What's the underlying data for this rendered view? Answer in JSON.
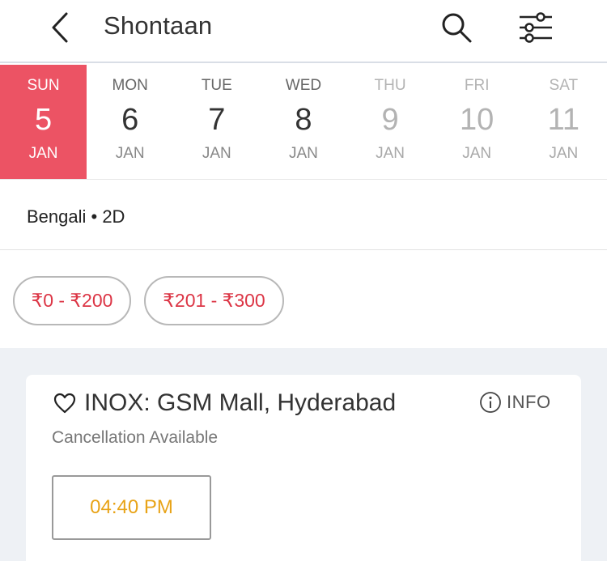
{
  "header": {
    "title": "Shontaan",
    "icons": {
      "back": "chevron-left-icon",
      "search": "search-icon",
      "filter": "sliders-icon"
    }
  },
  "dates": [
    {
      "dow": "SUN",
      "day": "5",
      "mon": "JAN",
      "state": "selected"
    },
    {
      "dow": "MON",
      "day": "6",
      "mon": "JAN",
      "state": "available"
    },
    {
      "dow": "TUE",
      "day": "7",
      "mon": "JAN",
      "state": "available"
    },
    {
      "dow": "WED",
      "day": "8",
      "mon": "JAN",
      "state": "available"
    },
    {
      "dow": "THU",
      "day": "9",
      "mon": "JAN",
      "state": "disabled"
    },
    {
      "dow": "FRI",
      "day": "10",
      "mon": "JAN",
      "state": "disabled"
    },
    {
      "dow": "SAT",
      "day": "11",
      "mon": "JAN",
      "state": "disabled"
    }
  ],
  "format": {
    "text": "Bengali • 2D"
  },
  "price_filters": [
    "₹0 - ₹200",
    "₹201 - ₹300"
  ],
  "venue": {
    "name": "INOX: GSM Mall, Hyderabad",
    "info_label": "INFO",
    "cancellation": "Cancellation Available",
    "showtime": "04:40 PM",
    "icons": {
      "favorite": "heart-outline-icon",
      "info": "info-circle-icon"
    }
  },
  "colors": {
    "selected_date_bg": "#ec5364",
    "price_text": "#dc3545",
    "showtime_text": "#e8a317",
    "list_bg": "#eef1f5"
  }
}
